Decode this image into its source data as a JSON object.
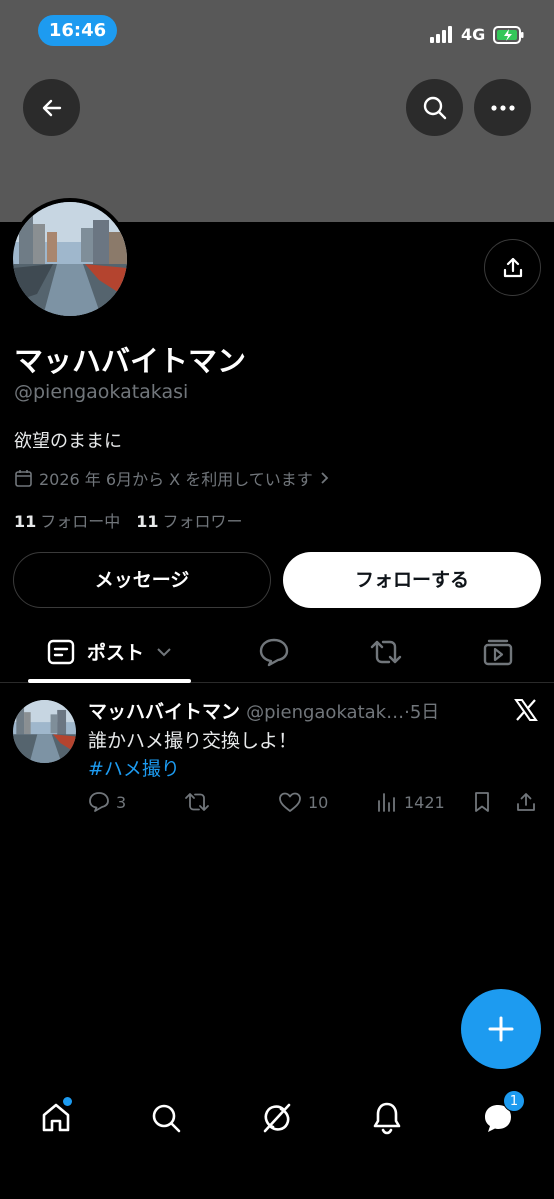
{
  "status_bar": {
    "time": "16:46",
    "network": "4G",
    "icons": [
      "signal-icon",
      "battery-charging-icon"
    ]
  },
  "header": {
    "icons": [
      "back-arrow-icon",
      "search-icon",
      "more-icon"
    ]
  },
  "profile": {
    "display_name": "マッハバイトマン",
    "handle": "@piengaokatakasi",
    "bio": "欲望のままに",
    "joined": "2026 年 6月から X を利用しています",
    "following_count": "11",
    "following_label": "フォロー中",
    "followers_count": "11",
    "followers_label": "フォロワー",
    "share_icon": "share-icon"
  },
  "buttons": {
    "message": "メッセージ",
    "follow": "フォローする"
  },
  "tabs": {
    "posts": "ポスト"
  },
  "tweet": {
    "name": "マッハバイトマン",
    "handle": "@piengaokatak…",
    "time": "·5日",
    "text": "誰かハメ撮り交換しよ！",
    "hashtag": "#ハメ撮り",
    "replies": "3",
    "retweets": "",
    "likes": "10",
    "views": "1421"
  },
  "bottom_nav": {
    "messages_badge": "1"
  },
  "colors": {
    "accent": "#1d9bf0",
    "banner": "#585858",
    "muted": "#71767b"
  }
}
